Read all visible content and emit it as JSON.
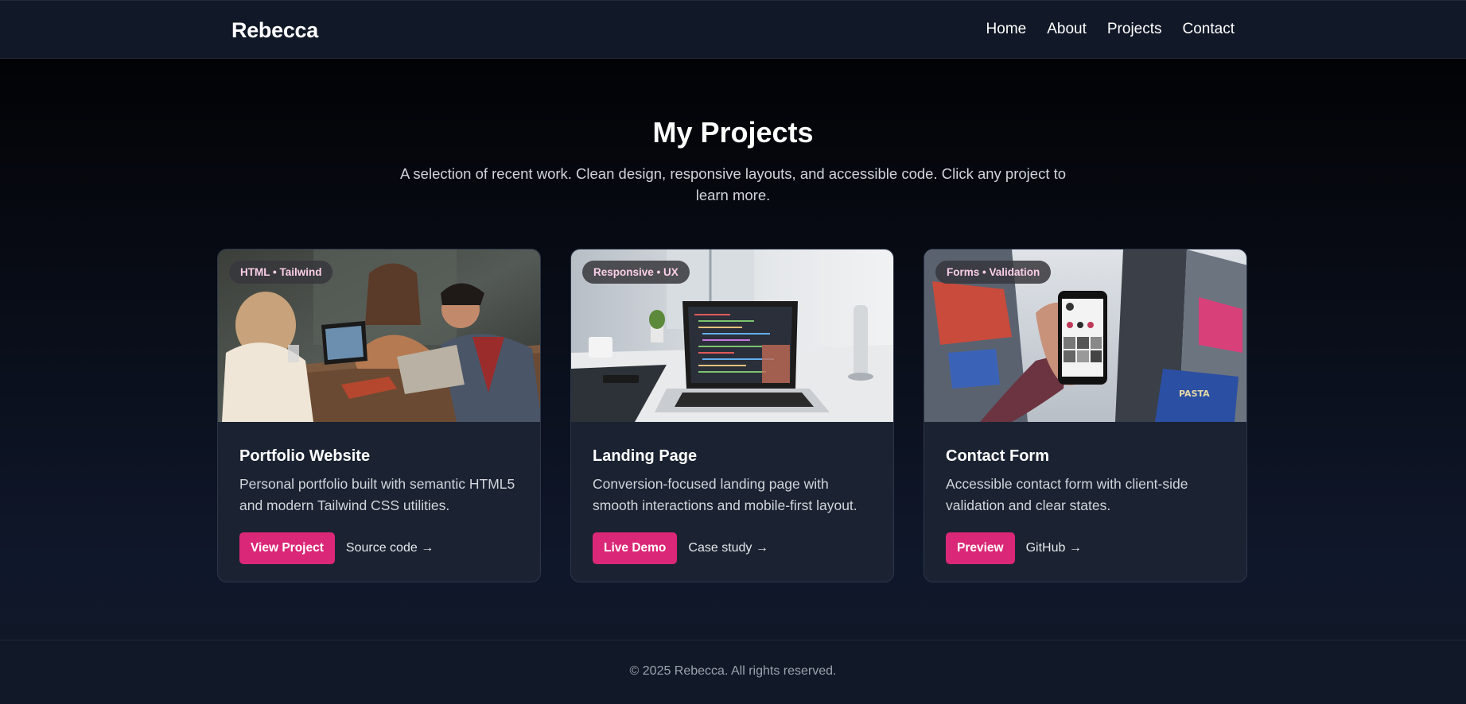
{
  "header": {
    "brand": "Rebecca",
    "nav": [
      "Home",
      "About",
      "Projects",
      "Contact"
    ]
  },
  "hero": {
    "title": "My Projects",
    "subtitle": "A selection of recent work. Clean design, responsive layouts, and accessible code. Click any project to learn more."
  },
  "projects": [
    {
      "tag": "HTML • Tailwind",
      "title": "Portfolio Website",
      "description": "Personal portfolio built with semantic HTML5 and modern Tailwind CSS utilities.",
      "primary_label": "View Project",
      "secondary_label": "Source code →"
    },
    {
      "tag": "Responsive • UX",
      "title": "Landing Page",
      "description": "Conversion-focused landing page with smooth interactions and mobile-first layout.",
      "primary_label": "Live Demo",
      "secondary_label": "Case study →"
    },
    {
      "tag": "Forms • Validation",
      "title": "Contact Form",
      "description": "Accessible contact form with client-side validation and clear states.",
      "primary_label": "Preview",
      "secondary_label": "GitHub →"
    }
  ],
  "footer": {
    "text": "© 2025 Rebecca. All rights reserved."
  },
  "colors": {
    "accent": "#db2777",
    "tag_text": "#fbcfe8",
    "card_bg": "#1b2332",
    "header_bg": "#111827"
  }
}
